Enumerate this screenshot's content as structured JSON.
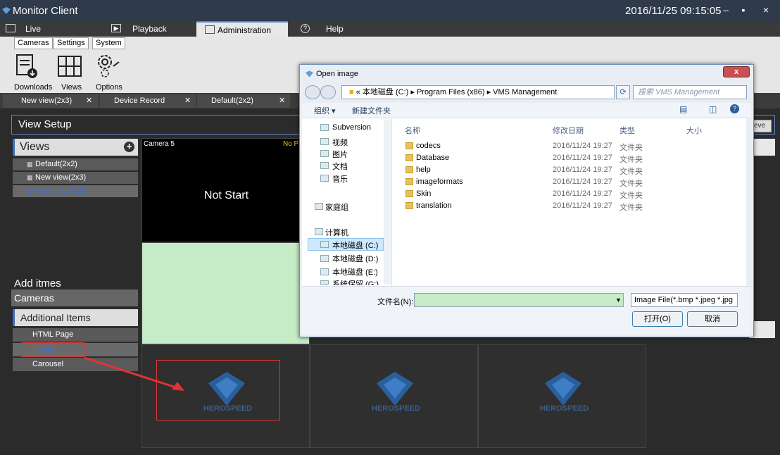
{
  "window": {
    "title": "Monitor Client",
    "clock": "2016/11/25 09:15:05"
  },
  "main_tabs": [
    {
      "label": "Live",
      "icon": "monitor-icon"
    },
    {
      "label": "Playback",
      "icon": "play-icon"
    },
    {
      "label": "Administration",
      "icon": "folder-icon"
    },
    {
      "label": "Help",
      "icon": "help-icon"
    }
  ],
  "ribbon": {
    "tabs": [
      "Cameras",
      "Settings",
      "System"
    ],
    "buttons": [
      "Downloads",
      "Views",
      "Options"
    ]
  },
  "view_tabs": [
    "New view(2x3)",
    "Device Record",
    "Default(2x2)"
  ],
  "view_setup": {
    "title": "View Setup",
    "leave_label": "eve"
  },
  "views": {
    "header": "Views",
    "items": [
      "Default(2x2)",
      "New view(2x3)",
      "New view(3x3)"
    ]
  },
  "add_items": {
    "title": "Add itmes",
    "cameras": "Cameras",
    "additional": "Additional Items",
    "items": [
      "HTML Page",
      "Image",
      "Carousel"
    ]
  },
  "grid": {
    "camera_label": "Camera 5",
    "status": "No P",
    "not_start": "Not Start",
    "logo_text": "HEROSPEED"
  },
  "dialog": {
    "title": "Open image",
    "address": [
      "本地磁盘 (C:)",
      "Program Files (x86)",
      "VMS Management"
    ],
    "search_placeholder": "搜索 VMS Management",
    "cmd_organize": "组织 ▾",
    "cmd_new_folder": "新建文件夹",
    "nav_items": [
      "Subversion",
      "视频",
      "图片",
      "文档",
      "音乐",
      "家庭组",
      "计算机",
      "本地磁盘 (C:)",
      "本地磁盘 (D:)",
      "本地磁盘 (E:)",
      "系统保留 (G:)"
    ],
    "columns": [
      "名称",
      "修改日期",
      "类型",
      "大小"
    ],
    "files": [
      {
        "name": "codecs",
        "date": "2016/11/24 19:27",
        "type": "文件夹"
      },
      {
        "name": "Database",
        "date": "2016/11/24 19:27",
        "type": "文件夹"
      },
      {
        "name": "help",
        "date": "2016/11/24 19:27",
        "type": "文件夹"
      },
      {
        "name": "imageformats",
        "date": "2016/11/24 19:27",
        "type": "文件夹"
      },
      {
        "name": "Skin",
        "date": "2016/11/24 19:27",
        "type": "文件夹"
      },
      {
        "name": "translation",
        "date": "2016/11/24 19:27",
        "type": "文件夹"
      }
    ],
    "filename_label": "文件名(N):",
    "filename_value": "",
    "filetype": "Image File(*.bmp *.jpeg *.jpg",
    "open_label": "打开(O)",
    "cancel_label": "取消"
  }
}
